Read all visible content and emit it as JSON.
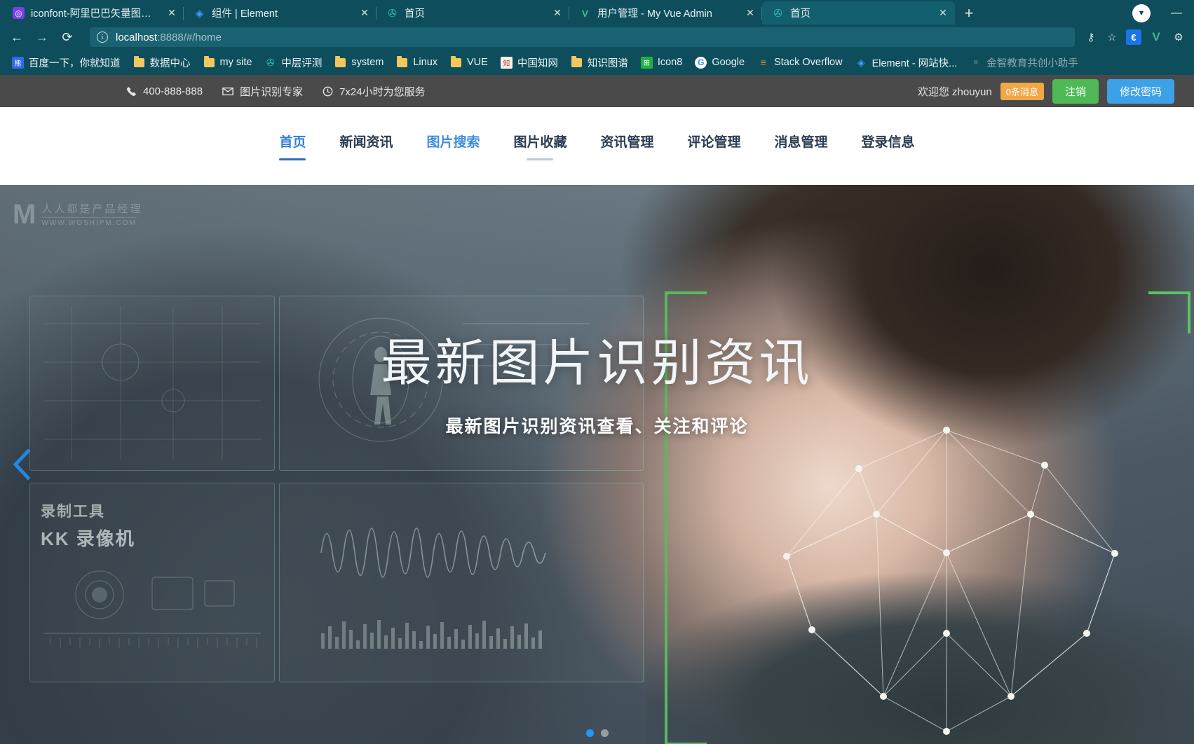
{
  "browser": {
    "tabs": [
      {
        "title": "iconfont-阿里巴巴矢量图标库",
        "favicon": "iconfont-icon",
        "favicon_color": "#7b3fe4",
        "favicon_glyph": "◎",
        "active": false,
        "close_label": "✕"
      },
      {
        "title": "组件 | Element",
        "favicon": "element-icon",
        "favicon_color": "#409eff",
        "favicon_glyph": "◈",
        "active": false,
        "close_label": "✕"
      },
      {
        "title": "首页",
        "favicon": "globe-icon",
        "favicon_color": "#2ec4b6",
        "favicon_glyph": "✇",
        "active": false,
        "close_label": "✕"
      },
      {
        "title": "用户管理 - My Vue Admin",
        "favicon": "vue-icon",
        "favicon_color": "#41b883",
        "favicon_glyph": "V",
        "active": false,
        "close_label": "✕"
      },
      {
        "title": "首页",
        "favicon": "globe-icon",
        "favicon_color": "#2ec4b6",
        "favicon_glyph": "✇",
        "active": true,
        "close_label": "✕"
      }
    ],
    "new_tab_label": "+",
    "profile_glyph": "▼",
    "window_controls": {
      "minimize": "—"
    },
    "navigation": {
      "back_label": "←",
      "forward_label": "→",
      "reload_label": "⟳",
      "site_info_glyph": "ⓘ",
      "url_host": "localhost",
      "url_path": ":8888/#/home"
    },
    "address_icons": [
      {
        "name": "password-key-icon",
        "glyph": "⚷"
      },
      {
        "name": "bookmark-star-icon",
        "glyph": "☆"
      }
    ],
    "extensions": [
      {
        "name": "euro-extension-icon",
        "glyph": "€",
        "bg": "#1a73e8",
        "fg": "#ffffff"
      },
      {
        "name": "vue-devtools-icon",
        "glyph": "V",
        "bg": "transparent",
        "fg": "#41b883"
      },
      {
        "name": "puzzle-extension-icon",
        "glyph": "⚙",
        "bg": "transparent",
        "fg": "#d7e6ea"
      }
    ],
    "bookmarks": [
      {
        "label": "百度一下，你就知道",
        "icon": "baidu-icon",
        "type": "site",
        "glyph": "熊",
        "bg": "#2e6be6",
        "fg": "#ffffff"
      },
      {
        "label": "数据中心",
        "icon": "folder-icon",
        "type": "folder"
      },
      {
        "label": "my site",
        "icon": "folder-icon",
        "type": "folder"
      },
      {
        "label": "中层评测",
        "icon": "globe-icon",
        "type": "site",
        "glyph": "✇",
        "bg": "transparent",
        "fg": "#37c2b5"
      },
      {
        "label": "system",
        "icon": "folder-icon",
        "type": "folder"
      },
      {
        "label": "Linux",
        "icon": "folder-icon",
        "type": "folder"
      },
      {
        "label": "VUE",
        "icon": "folder-icon",
        "type": "folder"
      },
      {
        "label": "中国知网",
        "icon": "cnki-icon",
        "type": "site",
        "glyph": "知",
        "bg": "#f5f2e8",
        "fg": "#c0392b"
      },
      {
        "label": "知识图谱",
        "icon": "folder-icon",
        "type": "folder"
      },
      {
        "label": "Icon8",
        "icon": "icons8-icon",
        "type": "site",
        "glyph": "⊞",
        "bg": "#1fb141",
        "fg": "#ffffff"
      },
      {
        "label": "Google",
        "icon": "google-icon",
        "type": "site",
        "glyph": "G",
        "bg": "#ffffff",
        "fg": "#4285f4"
      },
      {
        "label": "Stack Overflow",
        "icon": "stackoverflow-icon",
        "type": "site",
        "glyph": "≡",
        "bg": "transparent",
        "fg": "#f48024"
      },
      {
        "label": "Element - 网站快...",
        "icon": "element-icon",
        "type": "site",
        "glyph": "◈",
        "bg": "transparent",
        "fg": "#409eff"
      },
      {
        "label": "金智教育共创小助手",
        "icon": "faded-icon",
        "type": "site",
        "glyph": "■",
        "bg": "transparent",
        "fg": "#5d8a95",
        "faded": true
      }
    ]
  },
  "topbar": {
    "phone": "400-888-888",
    "phone_icon": "phone-icon",
    "phone_glyph": "📞",
    "email_text": "图片识别专家",
    "email_icon": "mail-icon",
    "email_glyph": "✉",
    "service_text": "7x24小时为您服务",
    "service_icon": "clock-icon",
    "service_glyph": "🕐",
    "welcome": "欢迎您 zhouyun",
    "message_badge": "0条消息",
    "logout_label": "注销",
    "change_password_label": "修改密码",
    "colors": {
      "bg": "#4a4a4a",
      "badge": "#f0a847",
      "logout": "#4fb955",
      "password": "#3da1e8"
    }
  },
  "nav": {
    "items": [
      {
        "label": "首页",
        "state": "active",
        "underline": "strong"
      },
      {
        "label": "新闻资讯",
        "state": "normal",
        "underline": "none"
      },
      {
        "label": "图片搜索",
        "state": "hover",
        "underline": "none"
      },
      {
        "label": "图片收藏",
        "state": "normal",
        "underline": "soft"
      },
      {
        "label": "资讯管理",
        "state": "normal",
        "underline": "none"
      },
      {
        "label": "评论管理",
        "state": "normal",
        "underline": "none"
      },
      {
        "label": "消息管理",
        "state": "normal",
        "underline": "none"
      },
      {
        "label": "登录信息",
        "state": "normal",
        "underline": "none"
      }
    ],
    "colors": {
      "active": "#2f7fd6",
      "normal": "#2a3d52",
      "underline_strong": "#2f6fb5",
      "underline_soft": "#b6cbe0"
    }
  },
  "hero": {
    "title": "最新图片识别资讯",
    "subtitle": "最新图片识别资讯查看、关注和评论",
    "watermark_brand": "M",
    "watermark_line1": "人人都是产品经理",
    "watermark_line2": "WWW.WOSHIPM.COM",
    "prev_arrow": "‹",
    "dots": [
      {
        "active": true
      },
      {
        "active": false
      }
    ],
    "tech_labels": {
      "record_tool": "录制工具",
      "recorder": "KK 录像机"
    },
    "accent_green": "#5cc463",
    "accent_blue": "#2196f3"
  }
}
